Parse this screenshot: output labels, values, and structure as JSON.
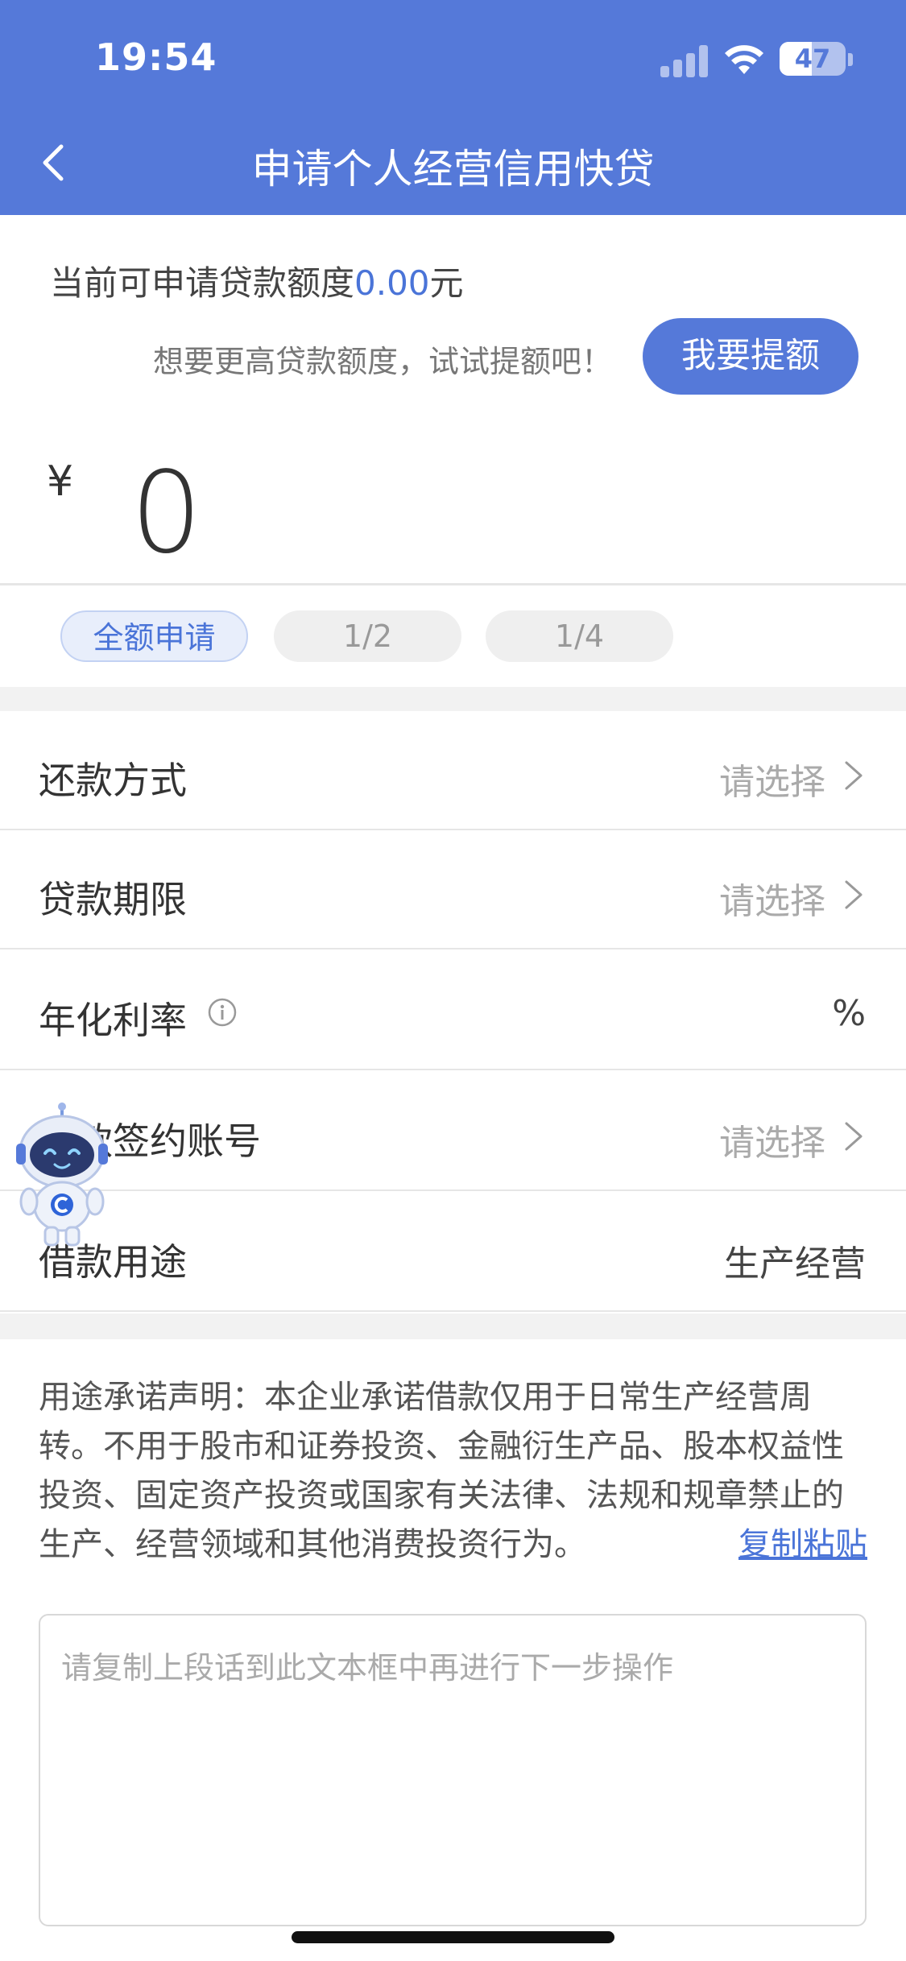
{
  "status_bar": {
    "time": "19:54",
    "battery": "47"
  },
  "header": {
    "title": "申请个人经营信用快贷"
  },
  "quota": {
    "prefix": "当前可申请贷款额度",
    "amount": "0.00",
    "unit": "元",
    "hint": "想要更高贷款额度，试试提额吧！",
    "raise_button": "我要提额"
  },
  "amount_input": {
    "currency": "¥",
    "value": "0"
  },
  "ratio_chips": [
    "全额申请",
    "1/2",
    "1/4"
  ],
  "form_rows": [
    {
      "label": "还款方式",
      "value": "请选择"
    },
    {
      "label": "贷款期限",
      "value": "请选择"
    },
    {
      "label": "年化利率",
      "value": "%"
    },
    {
      "label": "贷款签约账号",
      "value": "请选择"
    },
    {
      "label": "借款用途",
      "value": "生产经营"
    }
  ],
  "statement": {
    "text": "用途承诺声明：本企业承诺借款仅用于日常生产经营周转。不用于股市和证券投资、金融衍生产品、股本权益性投资、固定资产投资或国家有关法律、法规和规章禁止的生产、经营领域和其他消费投资行为。",
    "copy_link": "复制粘贴"
  },
  "textarea": {
    "placeholder": "请复制上段话到此文本框中再进行下一步操作"
  },
  "colors": {
    "primary": "#5579D9",
    "link": "#4a74d8"
  }
}
